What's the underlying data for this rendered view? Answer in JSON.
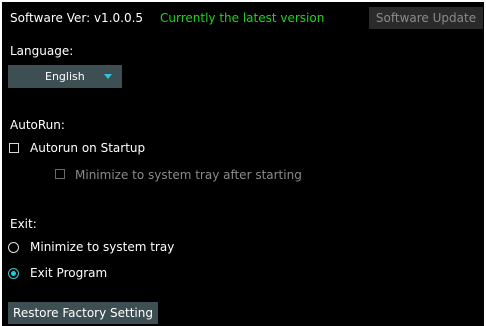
{
  "header": {
    "version_label": "Software Ver: v1.0.0.5",
    "status_text": "Currently the latest version",
    "update_button": "Software Update"
  },
  "language": {
    "label": "Language:",
    "selected": "English"
  },
  "autorun": {
    "label": "AutoRun:",
    "startup_option": "Autorun on Startup",
    "startup_checked": false,
    "tray_option": "Minimize to system tray after starting",
    "tray_checked": false,
    "tray_enabled": false
  },
  "exit": {
    "label": "Exit:",
    "options": [
      {
        "label": "Minimize to system tray",
        "selected": false
      },
      {
        "label": "Exit Program",
        "selected": true
      }
    ]
  },
  "footer": {
    "restore_button": "Restore Factory Setting"
  },
  "colors": {
    "background": "#000000",
    "status_green": "#1ed31e",
    "accent": "#2ec4d6",
    "control_bg": "#3d4f53"
  }
}
